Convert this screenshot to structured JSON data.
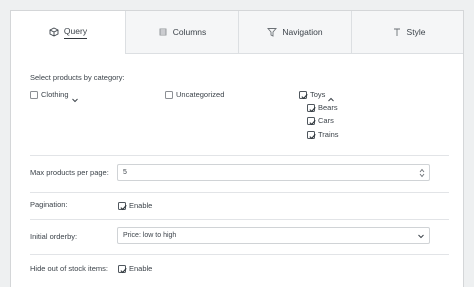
{
  "tabs": [
    {
      "label": "Query",
      "icon": "cube-icon",
      "active": true
    },
    {
      "label": "Columns",
      "icon": "columns-icon",
      "active": false
    },
    {
      "label": "Navigation",
      "icon": "filter-icon",
      "active": false
    },
    {
      "label": "Style",
      "icon": "text-style-icon",
      "active": false
    }
  ],
  "query": {
    "category_label": "Select products by category:",
    "categories": {
      "clothing": {
        "label": "Clothing",
        "checked": false
      },
      "uncategorized": {
        "label": "Uncategorized",
        "checked": false
      },
      "toys": {
        "label": "Toys",
        "checked": true
      },
      "bears": {
        "label": "Bears",
        "checked": true
      },
      "cars": {
        "label": "Cars",
        "checked": true
      },
      "trains": {
        "label": "Trains",
        "checked": true
      }
    },
    "max_products_label": "Max products per page:",
    "max_products_value": "5",
    "pagination_label": "Pagination:",
    "pagination_option": "Enable",
    "pagination_checked": true,
    "orderby_label": "Initial orderby:",
    "orderby_value": "Price: low to high",
    "hide_out_of_stock_label": "Hide out of stock items:",
    "hide_out_of_stock_option": "Enable",
    "hide_out_of_stock_checked": true
  }
}
